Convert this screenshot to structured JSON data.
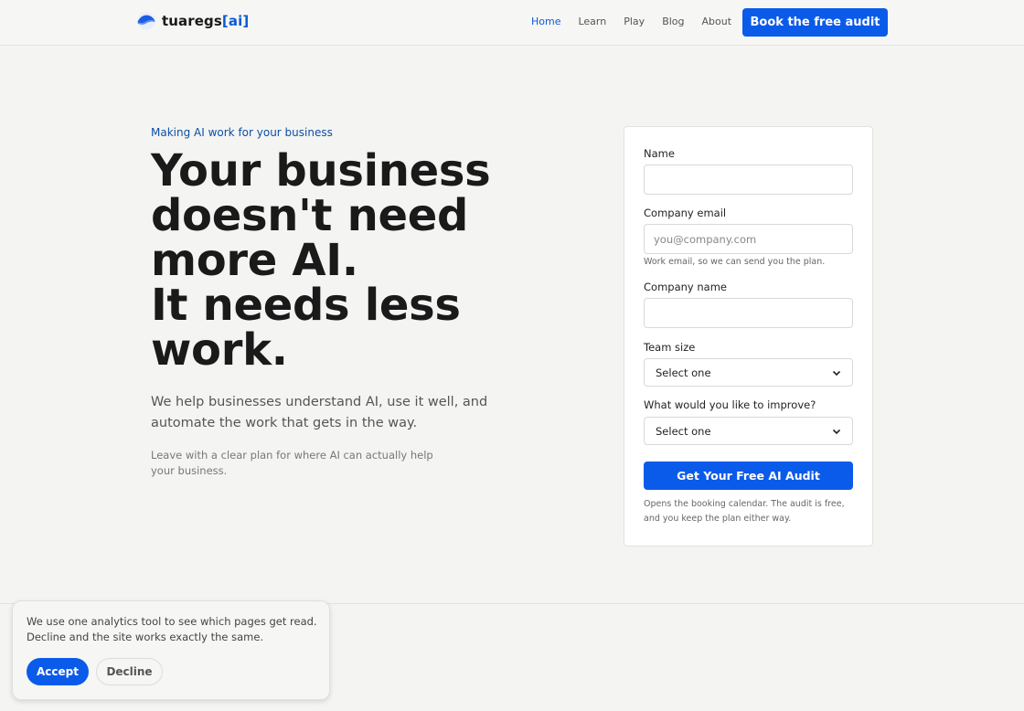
{
  "brand": {
    "name": "tuaregs",
    "accent": "[ai]",
    "accent_color": "#0b5bd3",
    "logo_icon": "wave-logo-icon"
  },
  "nav": {
    "items": [
      {
        "label": "Home",
        "active": true
      },
      {
        "label": "Learn",
        "active": false
      },
      {
        "label": "Play",
        "active": false
      },
      {
        "label": "Blog",
        "active": false
      },
      {
        "label": "About",
        "active": false
      }
    ],
    "cta_label": "Book the free audit"
  },
  "hero": {
    "eyebrow": "Making AI work for your business",
    "headline_lines": [
      "Your business",
      "doesn't need",
      "more AI.",
      "It needs less",
      "work."
    ],
    "lead": "We help businesses understand AI, use it well, and automate the work that gets in the way.",
    "sub": "Leave with a clear plan for where AI can actually help your business."
  },
  "form": {
    "name_label": "Name",
    "name_value": "",
    "email_label": "Company email",
    "email_placeholder": "you@company.com",
    "email_hint": "Work email, so we can send you the plan.",
    "company_label": "Company name",
    "company_value": "",
    "team_label": "Team size",
    "team_value": "Select one",
    "improve_label": "What would you like to improve?",
    "improve_value": "Select one",
    "submit_label": "Get Your Free AI Audit",
    "footnote": "Opens the booking calendar. The audit is free, and you keep the plan either way."
  },
  "cookie": {
    "text": "We use one analytics tool to see which pages get read. Decline and the site works exactly the same.",
    "accept_label": "Accept",
    "decline_label": "Decline"
  },
  "colors": {
    "primary": "#0b5bea",
    "background": "#f4f4f2"
  }
}
